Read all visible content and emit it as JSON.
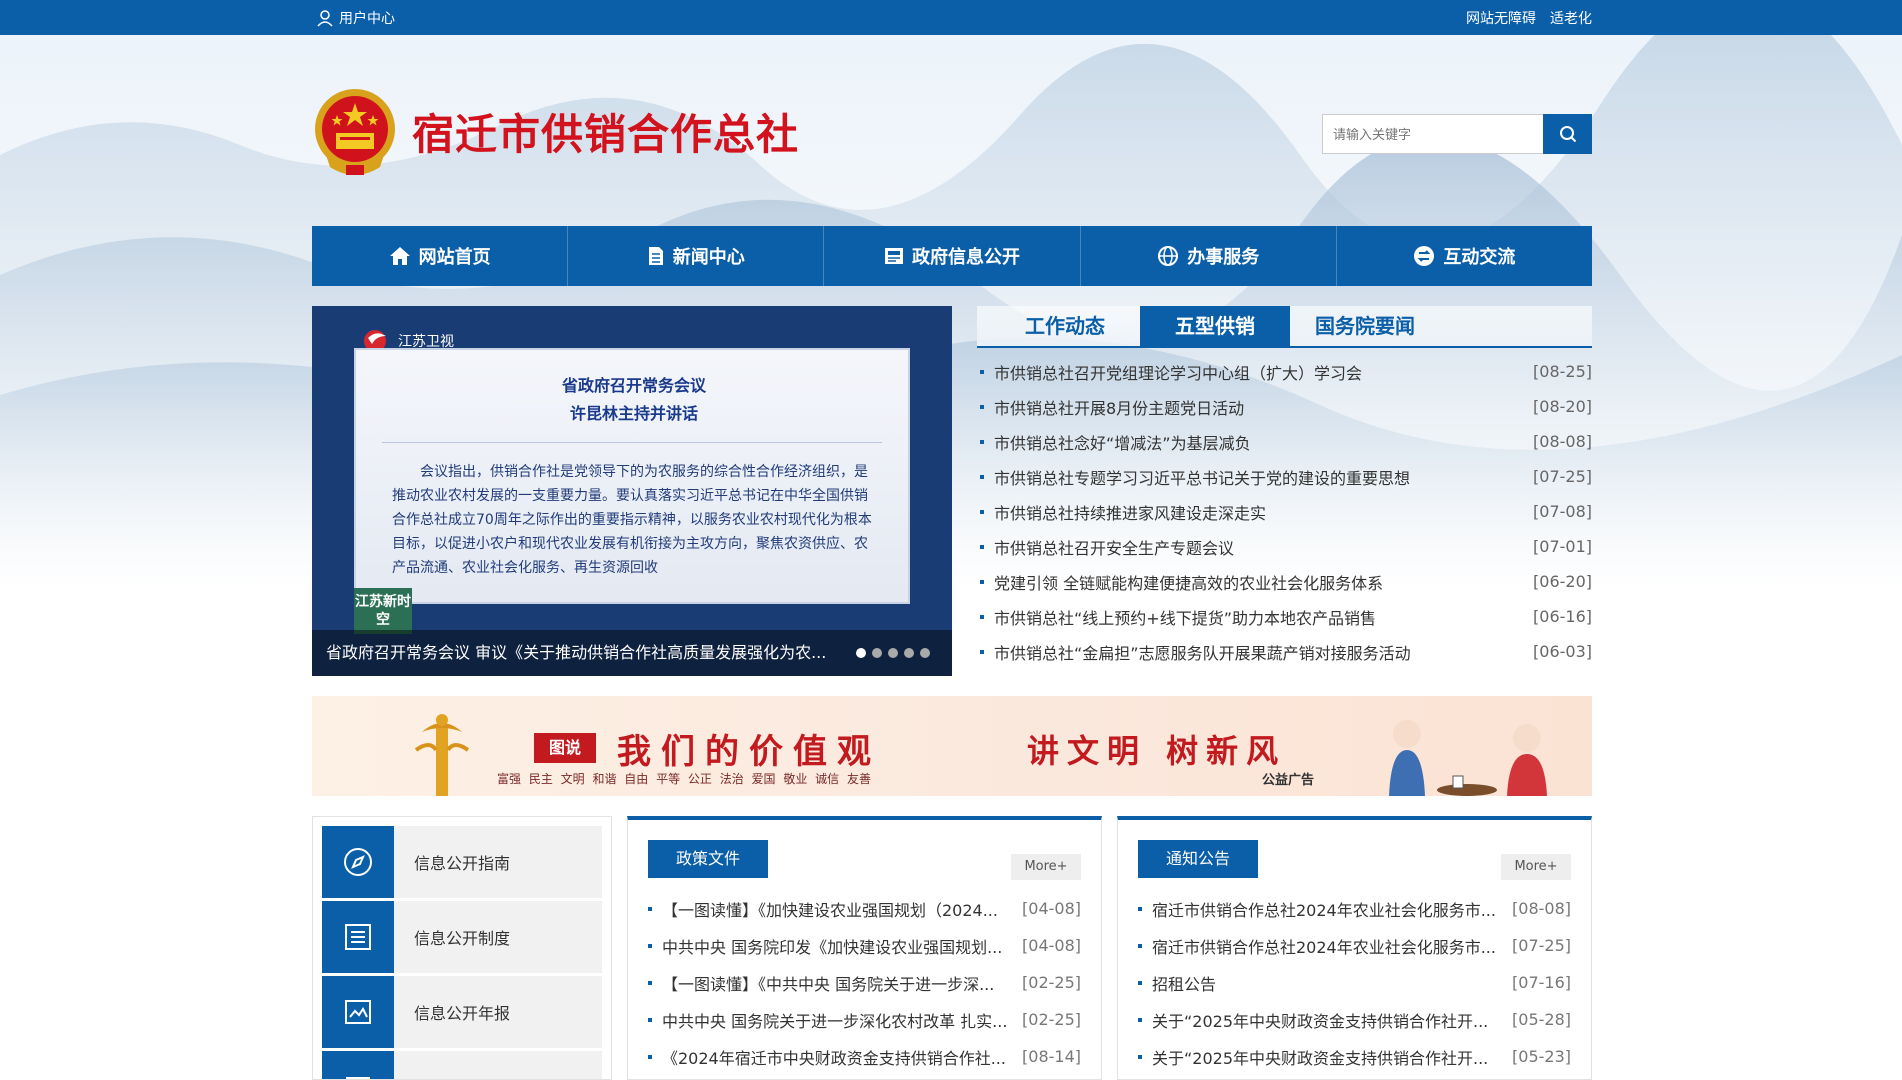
{
  "topbar": {
    "user_center": "用户中心",
    "accessibility": "网站无障碍",
    "elderly_mode": "适老化"
  },
  "header": {
    "site_title": "宿迁市供销合作总社",
    "search_placeholder": "请输入关键字"
  },
  "nav": [
    {
      "label": "网站首页",
      "icon": "home-icon"
    },
    {
      "label": "新闻中心",
      "icon": "document-icon"
    },
    {
      "label": "政府信息公开",
      "icon": "info-board-icon"
    },
    {
      "label": "办事服务",
      "icon": "globe-icon"
    },
    {
      "label": "互动交流",
      "icon": "exchange-icon"
    }
  ],
  "carousel": {
    "channel_logo": "江苏卫视",
    "heading1": "省政府召开常务会议",
    "heading2": "许昆林主持并讲话",
    "body": "会议指出，供销合作社是党领导下的为农服务的综合性合作经济组织，是推动农业农村发展的一支重要力量。要认真落实习近平总书记在中华全国供销合作总社成立70周年之际作出的重要指示精神，以服务农业农村现代化为根本目标，以促进小农户和现代农业发展有机衔接为主攻方向，聚焦农资供应、农产品流通、农业社会化服务、再生资源回收",
    "badge": "江苏新时空",
    "caption": "省政府召开常务会议 审议《关于推动供销合作社高质量发展强化为农...",
    "dot_count": 5,
    "active_dot": 0
  },
  "tabnews": {
    "tabs": [
      "工作动态",
      "五型供销",
      "国务院要闻"
    ],
    "active_tab": 1,
    "items": [
      {
        "title": "市供销总社召开党组理论学习中心组（扩大）学习会",
        "date": "[08-25]"
      },
      {
        "title": "市供销总社开展8月份主题党日活动",
        "date": "[08-20]"
      },
      {
        "title": "市供销总社念好“增减法”为基层减负",
        "date": "[08-08]"
      },
      {
        "title": "市供销总社专题学习习近平总书记关于党的建设的重要思想",
        "date": "[07-25]"
      },
      {
        "title": "市供销总社持续推进家风建设走深走实",
        "date": "[07-08]"
      },
      {
        "title": "市供销总社召开安全生产专题会议",
        "date": "[07-01]"
      },
      {
        "title": "党建引领 全链赋能构建便捷高效的农业社会化服务体系",
        "date": "[06-20]"
      },
      {
        "title": "市供销总社“线上预约+线下提货”助力本地农产品销售",
        "date": "[06-16]"
      },
      {
        "title": "市供销总社“金扁担”志愿服务队开展果蔬产销对接服务活动",
        "date": "[06-03]"
      }
    ]
  },
  "banner": {
    "tag": "图说",
    "values_title": "我们的价值观",
    "values_list": "富强 民主 文明 和谐 自由 平等 公正 法治 爱国 敬业 诚信 友善",
    "slogan": "讲文明 树新风",
    "psa": "公益广告"
  },
  "sidebar": [
    {
      "label": "信息公开指南",
      "icon": "compass-icon"
    },
    {
      "label": "信息公开制度",
      "icon": "list-icon"
    },
    {
      "label": "信息公开年报",
      "icon": "image-icon"
    },
    {
      "label": "",
      "icon": "folder-icon"
    }
  ],
  "policy": {
    "title": "政策文件",
    "more": "More+",
    "items": [
      {
        "title": "【一图读懂】《加快建设农业强国规划（2024...",
        "date": "[04-08]"
      },
      {
        "title": "中共中央 国务院印发《加快建设农业强国规划...",
        "date": "[04-08]"
      },
      {
        "title": "【一图读懂】《中共中央 国务院关于进一步深...",
        "date": "[02-25]"
      },
      {
        "title": "中共中央 国务院关于进一步深化农村改革 扎实...",
        "date": "[02-25]"
      },
      {
        "title": "《2024年宿迁市中央财政资金支持供销合作社...",
        "date": "[08-14]"
      }
    ]
  },
  "notice": {
    "title": "通知公告",
    "more": "More+",
    "items": [
      {
        "title": "宿迁市供销合作总社2024年农业社会化服务市...",
        "date": "[08-08]"
      },
      {
        "title": "宿迁市供销合作总社2024年农业社会化服务市...",
        "date": "[07-25]"
      },
      {
        "title": "招租公告",
        "date": "[07-16]"
      },
      {
        "title": "关于“2025年中央财政资金支持供销合作社开...",
        "date": "[05-28]"
      },
      {
        "title": "关于“2025年中央财政资金支持供销合作社开...",
        "date": "[05-23]"
      }
    ]
  },
  "colors": {
    "primary": "#0a5fa8",
    "title_red": "#d2121c"
  }
}
